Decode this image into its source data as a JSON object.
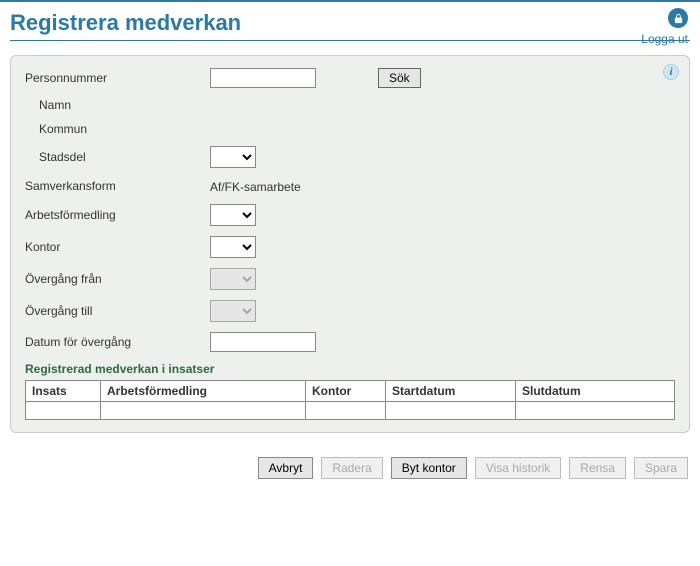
{
  "header": {
    "title": "Registrera medverkan",
    "logout": "Logga ut"
  },
  "form": {
    "personnummer_label": "Personnummer",
    "personnummer_value": "",
    "sok_label": "Sök",
    "namn_label": "Namn",
    "kommun_label": "Kommun",
    "stadsdel_label": "Stadsdel",
    "samverkansform_label": "Samverkansform",
    "samverkansform_value": "Af/FK-samarbete",
    "arbetsformedling_label": "Arbetsförmedling",
    "kontor_label": "Kontor",
    "overgang_fran_label": "Övergång från",
    "overgang_till_label": "Övergång till",
    "datum_overgang_label": "Datum för övergång",
    "datum_overgang_value": ""
  },
  "table": {
    "section_title": "Registrerad medverkan i insatser",
    "cols": {
      "insats": "Insats",
      "arbetsformedling": "Arbetsförmedling",
      "kontor": "Kontor",
      "startdatum": "Startdatum",
      "slutdatum": "Slutdatum"
    },
    "row": {
      "insats": "",
      "arbetsformedling": "",
      "kontor": "",
      "startdatum": "",
      "slutdatum": ""
    }
  },
  "footer": {
    "avbryt": "Avbryt",
    "radera": "Radera",
    "byt_kontor": "Byt kontor",
    "visa_historik": "Visa historik",
    "rensa": "Rensa",
    "spara": "Spara"
  }
}
